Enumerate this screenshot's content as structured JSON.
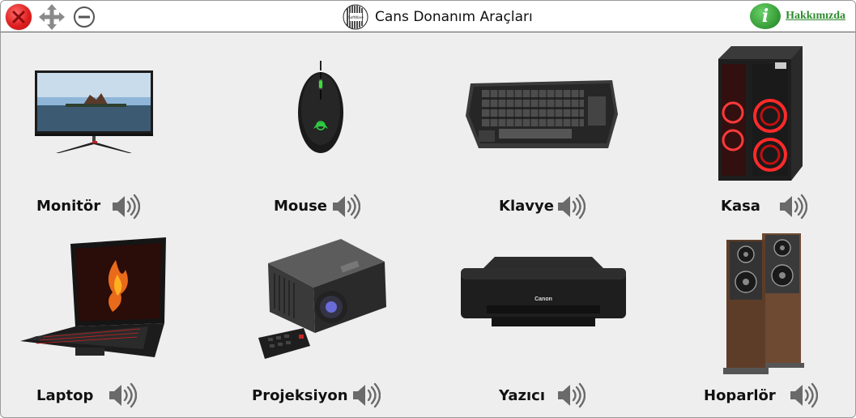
{
  "app": {
    "title": "Cans Donanım Araçları",
    "about_label": "Hakkımızda",
    "about_icon_glyph": "i"
  },
  "icons": {
    "close": "close-icon",
    "move": "move-icon",
    "minimize": "minimize-icon",
    "info": "info-icon",
    "speaker": "speaker-icon"
  },
  "colors": {
    "close_red": "#e02020",
    "info_green": "#3aa03a",
    "link_green": "#2e8b2e",
    "background": "#eeeeee"
  },
  "items": [
    {
      "label": "Monitör"
    },
    {
      "label": "Mouse"
    },
    {
      "label": "Klavye"
    },
    {
      "label": "Kasa"
    },
    {
      "label": "Laptop"
    },
    {
      "label": "Projeksiyon"
    },
    {
      "label": "Yazıcı"
    },
    {
      "label": "Hoparlör"
    }
  ]
}
